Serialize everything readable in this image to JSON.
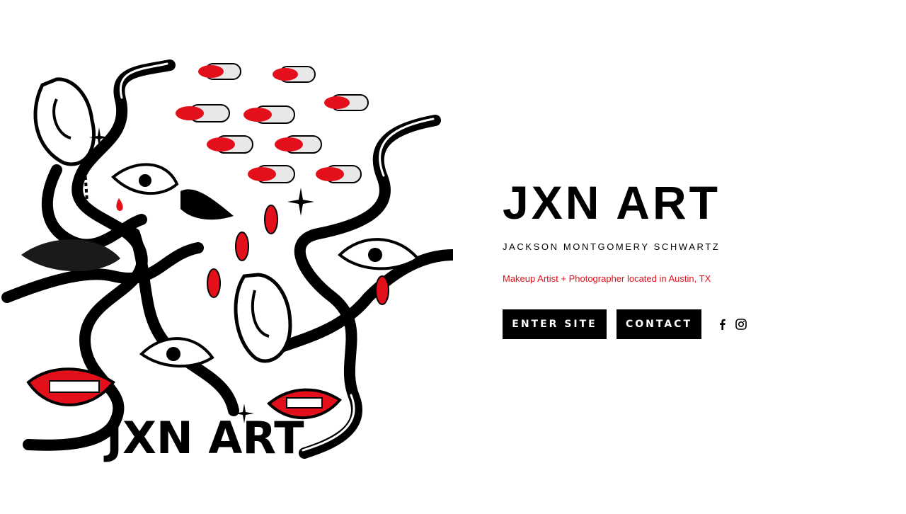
{
  "hero": {
    "title": "JXN ART",
    "subtitle": "JACKSON MONTGOMERY SCHWARTZ",
    "tagline": "Makeup Artist + Photographer located in Austin, TX",
    "accent_color": "#e3101b"
  },
  "artwork": {
    "logo_text": "JXN ART",
    "palette": [
      "#000000",
      "#e3101b",
      "#ffffff"
    ]
  },
  "actions": {
    "enter_label": "ENTER SITE",
    "contact_label": "CONTACT"
  },
  "social": [
    {
      "name": "facebook-icon"
    },
    {
      "name": "instagram-icon"
    }
  ]
}
